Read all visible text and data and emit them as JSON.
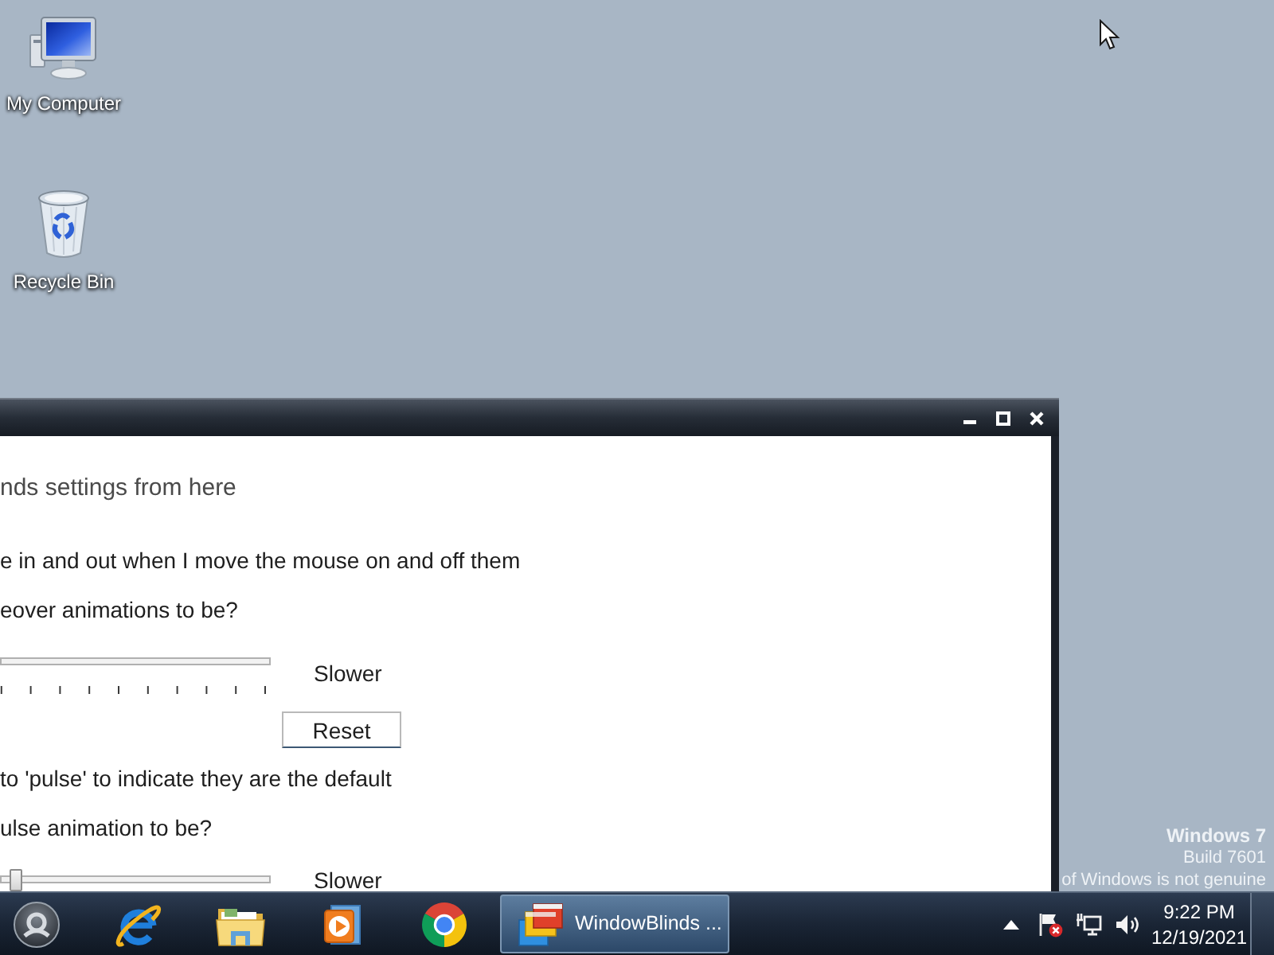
{
  "desktop": {
    "shortcuts": [
      {
        "label": "My Computer",
        "kind": "computer"
      },
      {
        "label": "Recycle Bin",
        "kind": "recycle-bin"
      }
    ],
    "watermark": {
      "title": "Windows 7",
      "build": "Build 7601",
      "notice": "of Windows is not genuine"
    }
  },
  "window": {
    "heading": "nds settings from here",
    "sections": [
      {
        "option": "e in and out when I move the mouse on and off them",
        "question": "eover animations to be?",
        "slider": {
          "scale": true
        },
        "slider_label": "Slower",
        "button": "Reset"
      },
      {
        "option": "to 'pulse' to indicate they are the default",
        "question": "ulse animation to be?",
        "slider": {
          "level": 0.06
        },
        "slider_label": "Slower"
      }
    ]
  },
  "taskbar": {
    "tasks": [
      {
        "label": "WindowBlinds ...",
        "selected": true
      }
    ],
    "clock": {
      "time": "9:22 PM",
      "date": "12/19/2021"
    }
  }
}
